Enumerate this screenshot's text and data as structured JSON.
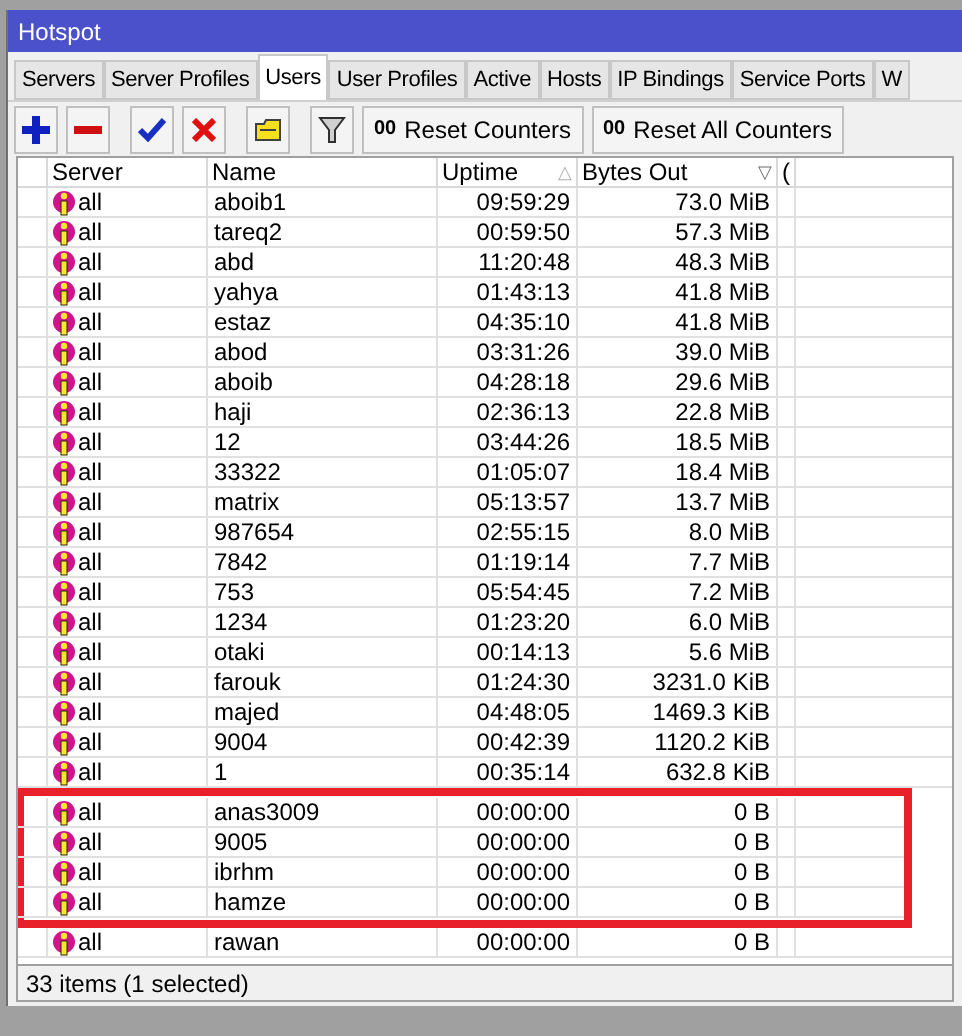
{
  "window": {
    "title": "Hotspot"
  },
  "tabs": [
    {
      "label": "Servers",
      "selected": false
    },
    {
      "label": "Server Profiles",
      "selected": false
    },
    {
      "label": "Users",
      "selected": true
    },
    {
      "label": "User Profiles",
      "selected": false
    },
    {
      "label": "Active",
      "selected": false
    },
    {
      "label": "Hosts",
      "selected": false
    },
    {
      "label": "IP Bindings",
      "selected": false
    },
    {
      "label": "Service Ports",
      "selected": false
    },
    {
      "label": "W",
      "selected": false
    }
  ],
  "toolbar": [
    {
      "kind": "add"
    },
    {
      "kind": "remove"
    },
    {
      "kind": "enable"
    },
    {
      "kind": "disable"
    },
    {
      "kind": "comment"
    },
    {
      "kind": "filter"
    },
    {
      "kind": "text",
      "label": "Reset Counters",
      "glyph": "00"
    },
    {
      "kind": "text",
      "label": "Reset All Counters",
      "glyph": "00"
    }
  ],
  "table": {
    "columns": [
      {
        "label": "Server"
      },
      {
        "label": "Name"
      },
      {
        "label": "Uptime",
        "sort_mark": "△"
      },
      {
        "label": "Bytes Out",
        "sort_mark": "▽"
      },
      {
        "label": "("
      }
    ],
    "rows": [
      {
        "server": "all",
        "name": "aboib1",
        "uptime": "09:59:29",
        "bytes_out": "73.0 MiB"
      },
      {
        "server": "all",
        "name": "tareq2",
        "uptime": "00:59:50",
        "bytes_out": "57.3 MiB"
      },
      {
        "server": "all",
        "name": "abd",
        "uptime": "11:20:48",
        "bytes_out": "48.3 MiB"
      },
      {
        "server": "all",
        "name": "yahya",
        "uptime": "01:43:13",
        "bytes_out": "41.8 MiB"
      },
      {
        "server": "all",
        "name": "estaz",
        "uptime": "04:35:10",
        "bytes_out": "41.8 MiB"
      },
      {
        "server": "all",
        "name": "abod",
        "uptime": "03:31:26",
        "bytes_out": "39.0 MiB"
      },
      {
        "server": "all",
        "name": "aboib",
        "uptime": "04:28:18",
        "bytes_out": "29.6 MiB"
      },
      {
        "server": "all",
        "name": "haji",
        "uptime": "02:36:13",
        "bytes_out": "22.8 MiB"
      },
      {
        "server": "all",
        "name": "12",
        "uptime": "03:44:26",
        "bytes_out": "18.5 MiB"
      },
      {
        "server": "all",
        "name": "33322",
        "uptime": "01:05:07",
        "bytes_out": "18.4 MiB"
      },
      {
        "server": "all",
        "name": "matrix",
        "uptime": "05:13:57",
        "bytes_out": "13.7 MiB"
      },
      {
        "server": "all",
        "name": "987654",
        "uptime": "02:55:15",
        "bytes_out": "8.0 MiB"
      },
      {
        "server": "all",
        "name": "7842",
        "uptime": "01:19:14",
        "bytes_out": "7.7 MiB"
      },
      {
        "server": "all",
        "name": "753",
        "uptime": "05:54:45",
        "bytes_out": "7.2 MiB"
      },
      {
        "server": "all",
        "name": "1234",
        "uptime": "01:23:20",
        "bytes_out": "6.0 MiB"
      },
      {
        "server": "all",
        "name": "otaki",
        "uptime": "00:14:13",
        "bytes_out": "5.6 MiB"
      },
      {
        "server": "all",
        "name": "farouk",
        "uptime": "01:24:30",
        "bytes_out": "3231.0 KiB"
      },
      {
        "server": "all",
        "name": "majed",
        "uptime": "04:48:05",
        "bytes_out": "1469.3 KiB"
      },
      {
        "server": "all",
        "name": "9004",
        "uptime": "00:42:39",
        "bytes_out": "1120.2 KiB"
      },
      {
        "server": "all",
        "name": "1",
        "uptime": "00:35:14",
        "bytes_out": "632.8 KiB"
      },
      {
        "server": "all",
        "name": "anas3009",
        "uptime": "00:00:00",
        "bytes_out": "0 B",
        "highlighted": true
      },
      {
        "server": "all",
        "name": "9005",
        "uptime": "00:00:00",
        "bytes_out": "0 B",
        "highlighted": true
      },
      {
        "server": "all",
        "name": "ibrhm",
        "uptime": "00:00:00",
        "bytes_out": "0 B",
        "highlighted": true
      },
      {
        "server": "all",
        "name": "hamze",
        "uptime": "00:00:00",
        "bytes_out": "0 B",
        "highlighted": true
      },
      {
        "server": "all",
        "name": "rawan",
        "uptime": "00:00:00",
        "bytes_out": "0 B"
      }
    ]
  },
  "status_bar": "33 items (1 selected)"
}
